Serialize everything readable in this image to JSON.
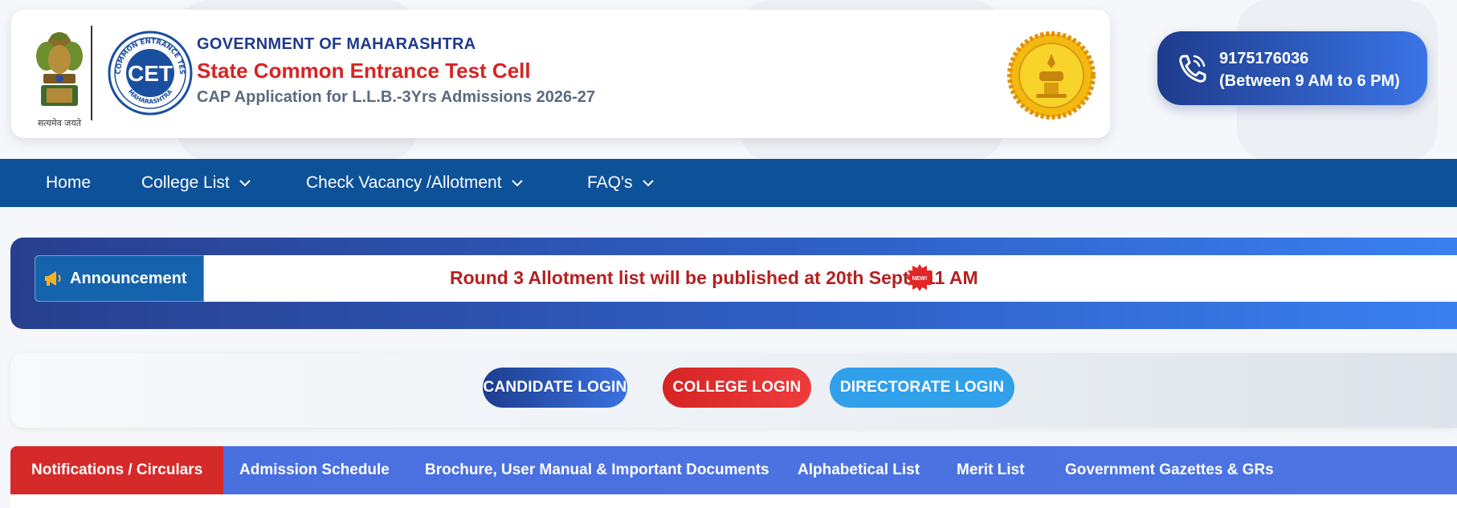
{
  "header": {
    "emblem_motto": "सत्यमेव जयते",
    "logo_ring_top": "STATE COMMON ENTRANCE TEST CELL",
    "logo_ring_bottom": "MAHARASHTRA",
    "logo_center": "CET",
    "gov_title": "GOVERNMENT OF MAHARASHTRA",
    "cell_title": "State Common Entrance Test Cell",
    "cap_title": "CAP Application for L.L.B.-3Yrs Admissions 2026-27"
  },
  "helpline": {
    "number": "9175176036",
    "hours": "(Between 9 AM to 6 PM)"
  },
  "nav": {
    "home": "Home",
    "college_list": "College List",
    "check_vacancy": "Check Vacancy /Allotment",
    "faqs": "FAQ's"
  },
  "announcement": {
    "label": "Announcement",
    "message": "Round 3 Allotment list will be published at 20th Sept - 11 AM",
    "badge": "NEW!"
  },
  "logins": {
    "candidate": "CANDIDATE LOGIN",
    "college": "COLLEGE LOGIN",
    "directorate": "DIRECTORATE LOGIN"
  },
  "tabs": {
    "notifications": "Notifications / Circulars",
    "schedule": "Admission Schedule",
    "brochure": "Brochure, User Manual & Important Documents",
    "alphabetical": "Alphabetical List",
    "merit": "Merit List",
    "gazettes": "Government Gazettes & GRs"
  },
  "colors": {
    "nav_bg": "#0d5199",
    "brand_blue": "#1f3a8a",
    "brand_red": "#d92323",
    "active_tab": "#d62a2a",
    "tabs_bg": "#4a6fe0"
  }
}
